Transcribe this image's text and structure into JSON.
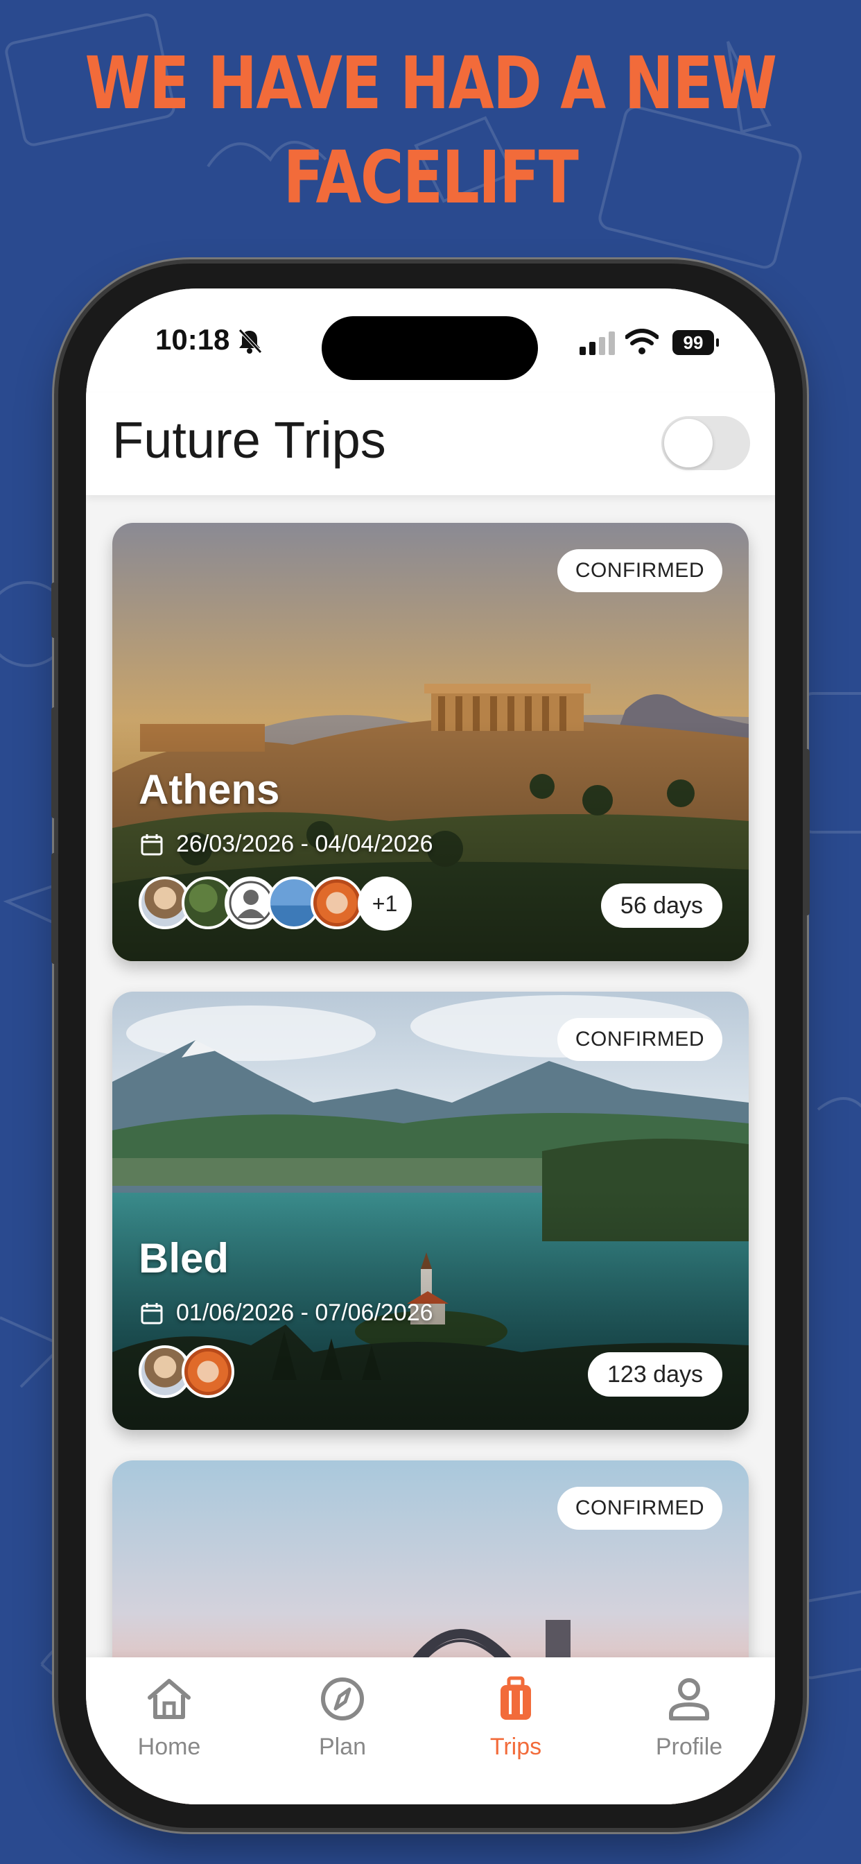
{
  "headline": {
    "line1": "WE HAVE HAD A NEW",
    "line2": "FACELIFT"
  },
  "colors": {
    "background": "#2a4a8f",
    "accent": "#f26b3a",
    "inactive_tab": "#888888"
  },
  "status_bar": {
    "time": "10:18",
    "battery": "99",
    "icons": [
      "bell-slash-icon",
      "signal-icon",
      "wifi-icon",
      "battery-icon"
    ]
  },
  "header": {
    "title": "Future Trips",
    "toggle_on": false
  },
  "trips": [
    {
      "city": "Athens",
      "status": "CONFIRMED",
      "dates": "26/03/2026 - 04/04/2026",
      "countdown": "56 days",
      "participant_avatars": 5,
      "extra_participants": "+1"
    },
    {
      "city": "Bled",
      "status": "CONFIRMED",
      "dates": "01/06/2026 - 07/06/2026",
      "countdown": "123 days",
      "participant_avatars": 2
    },
    {
      "status": "CONFIRMED"
    }
  ],
  "tab_bar": {
    "active": "Trips",
    "tabs": [
      {
        "label": "Home",
        "icon": "home-icon"
      },
      {
        "label": "Plan",
        "icon": "compass-icon"
      },
      {
        "label": "Trips",
        "icon": "suitcase-icon"
      },
      {
        "label": "Profile",
        "icon": "person-icon"
      }
    ]
  }
}
